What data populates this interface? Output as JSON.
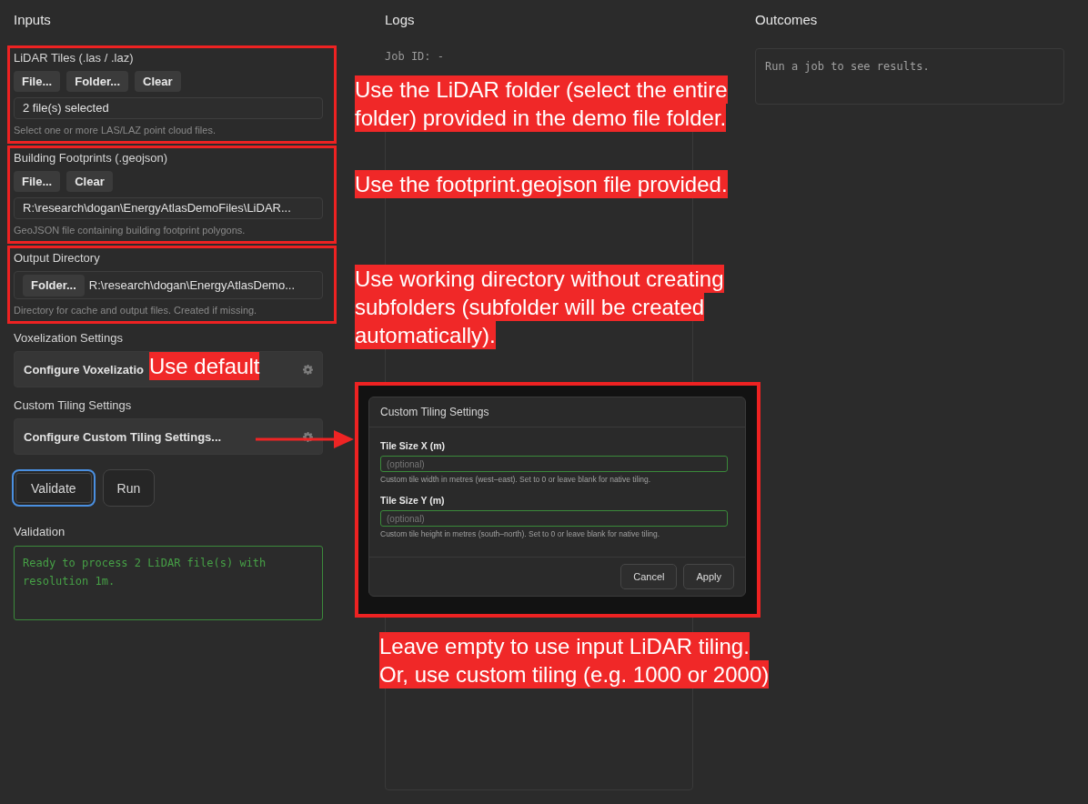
{
  "inputs": {
    "title": "Inputs",
    "sections": [
      {
        "kind": "files",
        "highlighted": true,
        "label": "LiDAR Tiles (.las / .laz)",
        "buttons": [
          "File...",
          "Folder...",
          "Clear"
        ],
        "value": "2 file(s) selected",
        "help": "Select one or more LAS/LAZ point cloud files."
      },
      {
        "kind": "files",
        "highlighted": true,
        "label": "Building Footprints (.geojson)",
        "buttons": [
          "File...",
          "Clear"
        ],
        "value": "R:\\research\\dogan\\EnergyAtlasDemoFiles\\LiDAR...",
        "help": "GeoJSON file containing building footprint polygons."
      },
      {
        "kind": "folder",
        "highlighted": true,
        "label": "Output Directory",
        "buttons": [
          "Folder..."
        ],
        "value": "R:\\research\\dogan\\EnergyAtlasDemo...",
        "help": "Directory for cache and output files. Created if missing."
      },
      {
        "kind": "settings",
        "highlighted": false,
        "label": "Voxelization Settings",
        "button": "Configure Voxelizatio"
      },
      {
        "kind": "settings",
        "highlighted": false,
        "label": "Custom Tiling Settings",
        "button": "Configure Custom Tiling Settings..."
      }
    ],
    "actions": [
      {
        "label": "Validate",
        "focused": true
      },
      {
        "label": "Run",
        "focused": false
      }
    ],
    "validation": {
      "label": "Validation",
      "message": "Ready to process 2 LiDAR file(s) with resolution 1m."
    }
  },
  "logs": {
    "title": "Logs",
    "job_id": "Job ID: -"
  },
  "outcomes": {
    "title": "Outcomes",
    "message": "Run a job to see results."
  },
  "dialog": {
    "highlighted": true,
    "title": "Custom Tiling Settings",
    "fields": [
      {
        "label": "Tile Size X (m)",
        "placeholder": "(optional)",
        "help": "Custom tile width in metres (west–east). Set to 0 or leave blank for native tiling."
      },
      {
        "label": "Tile Size Y (m)",
        "placeholder": "(optional)",
        "help": "Custom tile height in metres (south–north). Set to 0 or leave blank for native tiling."
      }
    ],
    "buttons": [
      "Cancel",
      "Apply"
    ]
  },
  "annotations": [
    {
      "text": "Use the LiDAR folder (select the entire\nfolder) provided in the demo file folder."
    },
    {
      "text": "Use the footprint.geojson file provided."
    },
    {
      "text": "Use working directory without creating\nsubfolders (subfolder will be created\nautomatically)."
    },
    {
      "text": "Use default"
    },
    {
      "text": "Leave empty to use input LiDAR tiling.\nOr, use custom tiling (e.g. 1000 or 2000)"
    }
  ]
}
